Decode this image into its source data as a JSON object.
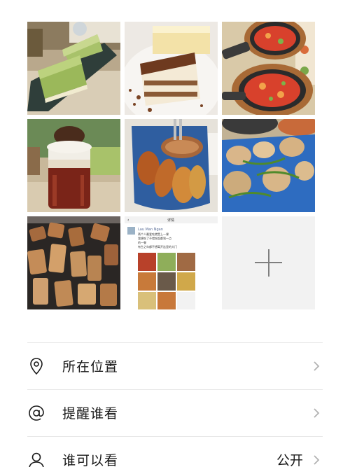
{
  "photos": [
    {
      "id": "photo-matcha-cake",
      "alt": "matcha cake"
    },
    {
      "id": "photo-tiramisu",
      "alt": "tiramisu"
    },
    {
      "id": "photo-pasta-pans",
      "alt": "pasta in skillets"
    },
    {
      "id": "photo-iced-drink",
      "alt": "iced drink"
    },
    {
      "id": "photo-chicken-wings",
      "alt": "chicken wings"
    },
    {
      "id": "photo-mushroom-dish",
      "alt": "mushroom dish"
    },
    {
      "id": "photo-grilled-meat",
      "alt": "grilled meat"
    },
    {
      "id": "photo-post-screenshot",
      "alt": "post screenshot"
    }
  ],
  "screenshot_post": {
    "header": "详情",
    "username": "Lau Man Ngan",
    "line1": "两个人最爱吃就是上一课",
    "line2": "我想吃了不错吃饭都到一点",
    "line3": "的一餐",
    "line4": "有生之年都不想离开这里的大门"
  },
  "add_photo": {
    "icon": "plus-icon"
  },
  "settings": [
    {
      "label": "所在位置",
      "icon": "location-pin-icon",
      "value": ""
    },
    {
      "label": "提醒谁看",
      "icon": "at-sign-icon",
      "value": ""
    },
    {
      "label": "谁可以看",
      "icon": "person-icon",
      "value": "公开"
    }
  ],
  "colors": {
    "text": "#1a1a1a",
    "divider": "#e6e6e6",
    "chevron": "#b2b2b2",
    "add_tile_bg": "#f2f2f2",
    "plus": "#7f7f7f"
  }
}
